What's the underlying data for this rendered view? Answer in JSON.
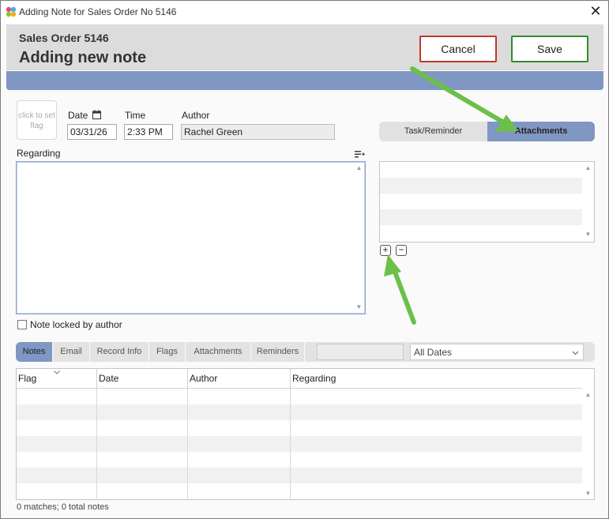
{
  "window": {
    "title": "Adding Note for Sales Order No 5146",
    "close_glyph": "✕"
  },
  "header": {
    "subtitle": "Sales Order 5146",
    "title": "Adding new note",
    "cancel_label": "Cancel",
    "save_label": "Save"
  },
  "form": {
    "flag_placeholder": "click to set flag",
    "date_label": "Date",
    "date_value": "03/31/26",
    "time_label": "Time",
    "time_value": "2:33 PM",
    "author_label": "Author",
    "author_value": "Rachel Green",
    "regarding_label": "Regarding",
    "locked_label": "Note locked by author"
  },
  "side_tabs": {
    "task_label": "Task/Reminder",
    "attachments_label": "Attachments",
    "active": "Attachments"
  },
  "attachment_controls": {
    "add_glyph": "+",
    "remove_glyph": "−"
  },
  "bottom_tabs": {
    "items": [
      {
        "label": "Notes",
        "active": true
      },
      {
        "label": "Email",
        "active": false
      },
      {
        "label": "Record Info",
        "active": false
      },
      {
        "label": "Flags",
        "active": false
      },
      {
        "label": "Attachments",
        "active": false
      },
      {
        "label": "Reminders",
        "active": false
      }
    ]
  },
  "filter": {
    "dates_value": "All Dates"
  },
  "grid": {
    "columns": [
      "Flag",
      "Date",
      "Author",
      "Regarding"
    ],
    "rows": []
  },
  "status": {
    "text": "0 matches; 0 total notes"
  },
  "colors": {
    "accent": "#7f97c2",
    "cancel_border": "#c0392b",
    "save_border": "#2e8b2e",
    "annotation_arrow": "#6cc04a"
  }
}
